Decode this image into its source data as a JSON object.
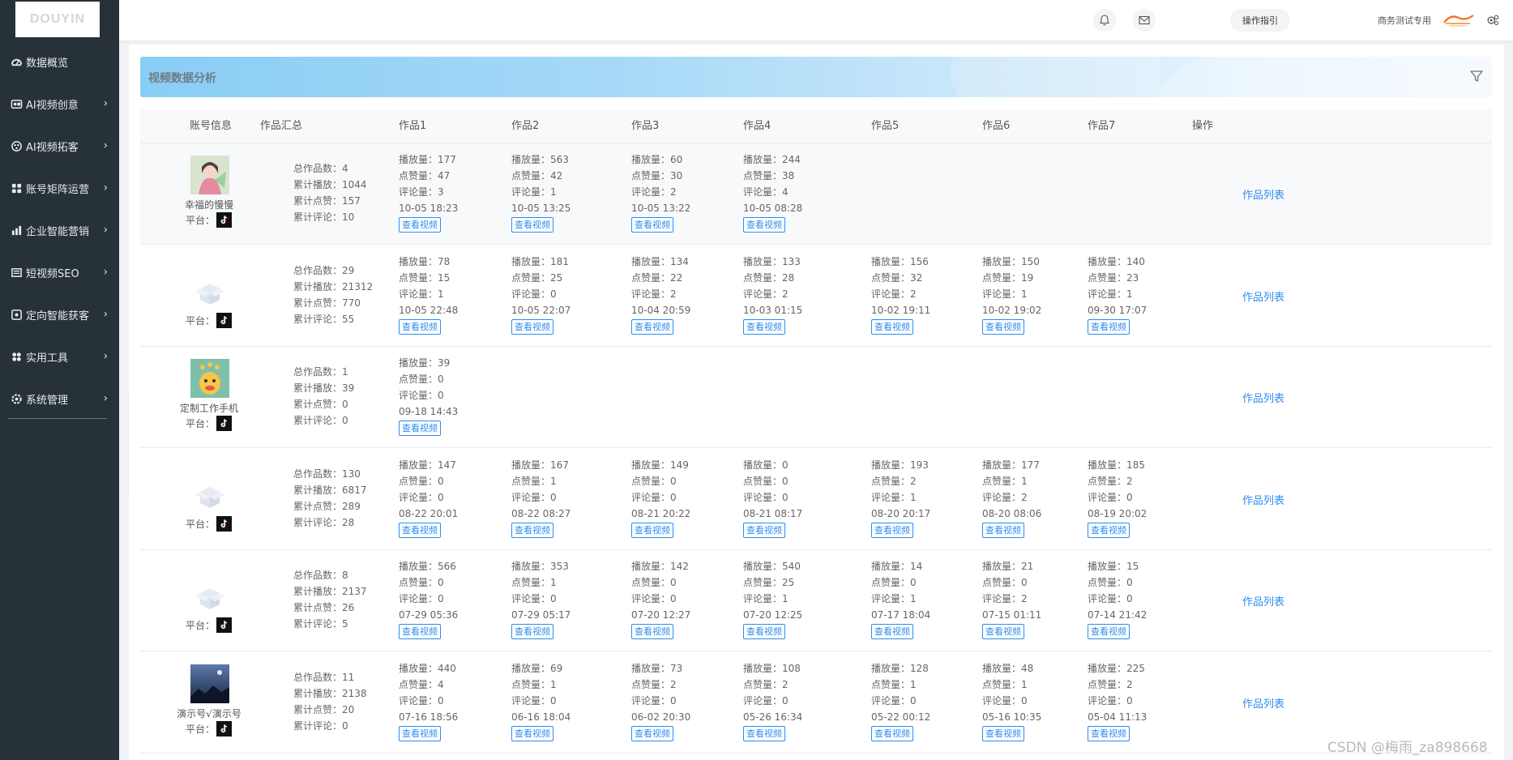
{
  "logo": {
    "text": "DOUYIN"
  },
  "sidebar": {
    "items": [
      {
        "label": "数据概览",
        "icon": "dashboard-icon",
        "has_arrow": false
      },
      {
        "label": "AI视频创意",
        "icon": "video-icon",
        "has_arrow": true
      },
      {
        "label": "AI视频拓客",
        "icon": "globe-icon",
        "has_arrow": true
      },
      {
        "label": "账号矩阵运营",
        "icon": "matrix-icon",
        "has_arrow": true
      },
      {
        "label": "企业智能营销",
        "icon": "bar-chart-icon",
        "has_arrow": true
      },
      {
        "label": "短视频SEO",
        "icon": "seo-icon",
        "has_arrow": true
      },
      {
        "label": "定向智能获客",
        "icon": "target-icon",
        "has_arrow": true
      },
      {
        "label": "实用工具",
        "icon": "tools-icon",
        "has_arrow": true
      },
      {
        "label": "系统管理",
        "icon": "settings-icon",
        "has_arrow": true
      }
    ]
  },
  "header": {
    "guide_label": "操作指引",
    "user_name": "商务测试专用"
  },
  "panel": {
    "title": "视频数据分析"
  },
  "table": {
    "columns": [
      "账号信息",
      "作品汇总",
      "作品1",
      "作品2",
      "作品3",
      "作品4",
      "作品5",
      "作品6",
      "作品7",
      "操作"
    ],
    "platform_label": "平台：",
    "labels": {
      "total_works": "总作品数：",
      "total_plays": "累计播放：",
      "total_likes": "累计点赞：",
      "total_comments": "累计评论：",
      "plays": "播放量：",
      "likes": "点赞量：",
      "comments": "评论量：",
      "view_video": "查看视频",
      "works_list": "作品列表"
    },
    "rows": [
      {
        "name": "幸福的慢慢",
        "avatar": "anime",
        "summary": {
          "works": "4",
          "plays": "1044",
          "likes": "157",
          "comments": "10"
        },
        "works": [
          {
            "plays": "177",
            "likes": "47",
            "comments": "3",
            "time": "10-05 18:23"
          },
          {
            "plays": "563",
            "likes": "42",
            "comments": "1",
            "time": "10-05 13:25"
          },
          {
            "plays": "60",
            "likes": "30",
            "comments": "2",
            "time": "10-05 13:22"
          },
          {
            "plays": "244",
            "likes": "38",
            "comments": "4",
            "time": "10-05 08:28"
          }
        ]
      },
      {
        "name": "",
        "avatar": "placeholder",
        "summary": {
          "works": "29",
          "plays": "21312",
          "likes": "770",
          "comments": "55"
        },
        "works": [
          {
            "plays": "78",
            "likes": "15",
            "comments": "1",
            "time": "10-05 22:48"
          },
          {
            "plays": "181",
            "likes": "25",
            "comments": "0",
            "time": "10-05 22:07"
          },
          {
            "plays": "134",
            "likes": "22",
            "comments": "2",
            "time": "10-04 20:59"
          },
          {
            "plays": "133",
            "likes": "28",
            "comments": "2",
            "time": "10-03 01:15"
          },
          {
            "plays": "156",
            "likes": "32",
            "comments": "2",
            "time": "10-02 19:11"
          },
          {
            "plays": "150",
            "likes": "19",
            "comments": "1",
            "time": "10-02 19:02"
          },
          {
            "plays": "140",
            "likes": "23",
            "comments": "1",
            "time": "09-30 17:07"
          }
        ]
      },
      {
        "name": "定制工作手机",
        "avatar": "cartoon",
        "summary": {
          "works": "1",
          "plays": "39",
          "likes": "0",
          "comments": "0"
        },
        "works": [
          {
            "plays": "39",
            "likes": "0",
            "comments": "0",
            "time": "09-18 14:43"
          }
        ]
      },
      {
        "name": "",
        "avatar": "placeholder",
        "summary": {
          "works": "130",
          "plays": "6817",
          "likes": "289",
          "comments": "28"
        },
        "works": [
          {
            "plays": "147",
            "likes": "0",
            "comments": "0",
            "time": "08-22 20:01"
          },
          {
            "plays": "167",
            "likes": "1",
            "comments": "0",
            "time": "08-22 08:27"
          },
          {
            "plays": "149",
            "likes": "0",
            "comments": "0",
            "time": "08-21 20:22"
          },
          {
            "plays": "0",
            "likes": "0",
            "comments": "0",
            "time": "08-21 08:17"
          },
          {
            "plays": "193",
            "likes": "2",
            "comments": "1",
            "time": "08-20 20:17"
          },
          {
            "plays": "177",
            "likes": "1",
            "comments": "2",
            "time": "08-20 08:06"
          },
          {
            "plays": "185",
            "likes": "2",
            "comments": "0",
            "time": "08-19 20:02"
          }
        ]
      },
      {
        "name": "",
        "avatar": "placeholder",
        "summary": {
          "works": "8",
          "plays": "2137",
          "likes": "26",
          "comments": "5"
        },
        "works": [
          {
            "plays": "566",
            "likes": "0",
            "comments": "0",
            "time": "07-29 05:36"
          },
          {
            "plays": "353",
            "likes": "1",
            "comments": "0",
            "time": "07-29 05:17"
          },
          {
            "plays": "142",
            "likes": "0",
            "comments": "0",
            "time": "07-20 12:27"
          },
          {
            "plays": "540",
            "likes": "25",
            "comments": "1",
            "time": "07-20 12:25"
          },
          {
            "plays": "14",
            "likes": "0",
            "comments": "1",
            "time": "07-17 18:04"
          },
          {
            "plays": "21",
            "likes": "0",
            "comments": "2",
            "time": "07-15 01:11"
          },
          {
            "plays": "15",
            "likes": "0",
            "comments": "0",
            "time": "07-14 21:42"
          }
        ]
      },
      {
        "name": "演示号√演示号",
        "avatar": "night",
        "summary": {
          "works": "11",
          "plays": "2138",
          "likes": "20",
          "comments": "0"
        },
        "works": [
          {
            "plays": "440",
            "likes": "4",
            "comments": "0",
            "time": "07-16 18:56"
          },
          {
            "plays": "69",
            "likes": "1",
            "comments": "0",
            "time": "06-16 18:04"
          },
          {
            "plays": "73",
            "likes": "2",
            "comments": "0",
            "time": "06-02 20:30"
          },
          {
            "plays": "108",
            "likes": "2",
            "comments": "0",
            "time": "05-26 16:34"
          },
          {
            "plays": "128",
            "likes": "1",
            "comments": "0",
            "time": "05-22 00:12"
          },
          {
            "plays": "48",
            "likes": "1",
            "comments": "0",
            "time": "05-16 10:35"
          },
          {
            "plays": "225",
            "likes": "2",
            "comments": "0",
            "time": "05-04 11:13"
          }
        ]
      }
    ]
  },
  "watermark": "CSDN @梅雨_za898668",
  "colors": {
    "sidebar_bg": "#263238",
    "link": "#2d8cf0",
    "banner": "#89cdf6"
  }
}
